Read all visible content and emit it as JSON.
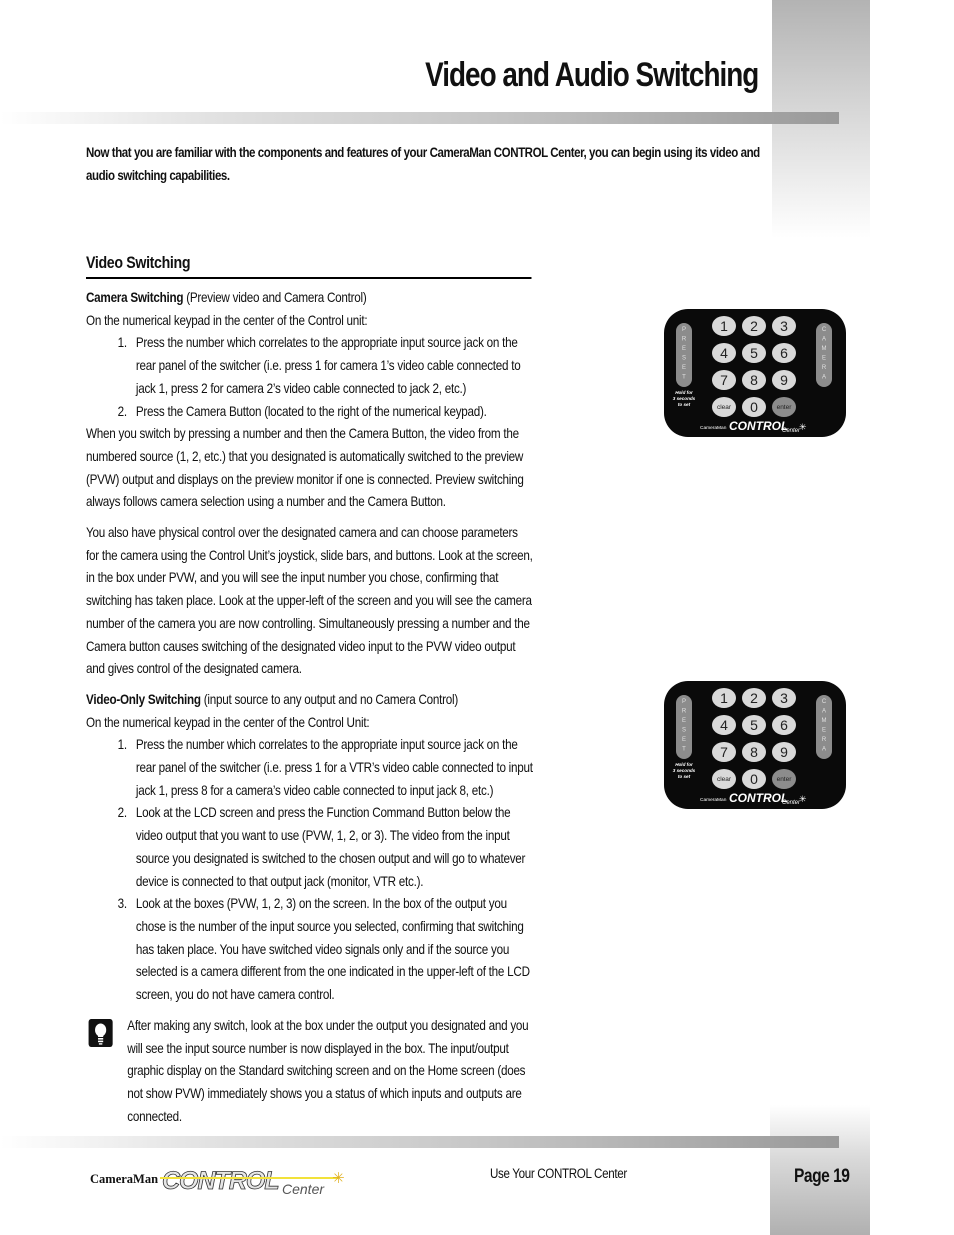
{
  "header": {
    "title": "Video and Audio Switching"
  },
  "intro": "Now that you are familiar with the components and features of your CameraMan CONTROL Center, you can begin using its video and audio switching capabilities.",
  "section": {
    "heading": "Video Switching",
    "camera_switching": {
      "title": "Camera Switching",
      "subtitle": " (Preview video and Camera Control)",
      "lead": "On the numerical keypad in the center of the Control unit:",
      "steps": [
        "Press the number which correlates to the appropriate input source jack on the rear panel of the switcher (i.e. press 1 for camera 1’s video cable connected to jack 1, press 2 for camera 2’s video cable connected to jack 2, etc.)",
        "Press the Camera Button (located to the right of the numerical keypad)."
      ],
      "para1": "When you switch by pressing a number and then the Camera Button, the video from the numbered source (1, 2, etc.) that you designated is automatically switched to the preview (PVW) output  and displays on the preview monitor if one is connected. Preview switching always follows camera selection using a number and the Camera Button.",
      "para2": "You also have physical control over the designated camera and can choose parameters for the camera using the Control Unit’s joystick, slide bars, and buttons. Look at the screen, in the box under PVW, and you will see the input number you chose, confirming that switching has taken place. Look at the upper-left of the screen and you will see the camera number of the camera you are now controlling. Simultaneously pressing a number and the Camera button causes switching of the designated video input to the PVW video output and gives control of the designated camera."
    },
    "video_only": {
      "title": "Video-Only Switching",
      "subtitle": " (input source to any output and no Camera Control)",
      "lead": "On the numerical keypad in the center of the Control Unit:",
      "steps": [
        "Press the number which correlates to the appropriate input source jack on the rear panel of the switcher (i.e. press 1 for a VTR’s video cable connected to input jack 1, press 8 for a camera’s  video cable connected to input jack 8, etc.)",
        "Look at the LCD screen and press the Function Command Button below the video output that you want to use (PVW, 1, 2, or 3). The video from the input source you designated is switched to the chosen output and will go to whatever device is connected to that output jack (monitor, VTR etc.).",
        "Look at the boxes (PVW, 1, 2, 3) on the screen. In the box of the output you chose is the number of the input source you selected, confirming that switching has taken place. You have switched video signals only and if the source you selected is a camera different from the one indicated in the upper-left of the LCD screen, you do not have camera control."
      ]
    },
    "tip": {
      "icon": "lightbulb-icon",
      "text": "After making any switch, look at the box under the output you designated and you will see the input source number is now displayed in the box. The input/output graphic display on the Standard switching screen and on the Home screen (does not show PVW) immediately shows you a status of which inputs and outputs are connected."
    }
  },
  "keypad": {
    "preset_label": "PRESET",
    "camera_label": "CAMERA",
    "hold_note": [
      "Hold for",
      "3 seconds",
      "to set"
    ],
    "keys": [
      "1",
      "2",
      "3",
      "4",
      "5",
      "6",
      "7",
      "8",
      "9",
      "clear",
      "0",
      "enter"
    ],
    "brand_small": "CameraMan",
    "brand_big": "CONTROL",
    "brand_script": "Center"
  },
  "footer": {
    "logo_prefix": "CameraMan",
    "logo_main": "CONTROL",
    "logo_suffix": "Center",
    "center_text": "Use Your CONTROL Center",
    "page_label": "Page 19"
  },
  "colors": {
    "keypad_body": "#0a0a0a",
    "key_light": "#d9d9d9",
    "key_dark": "#8c8c8c",
    "accent_yellow": "#f2e23a"
  }
}
